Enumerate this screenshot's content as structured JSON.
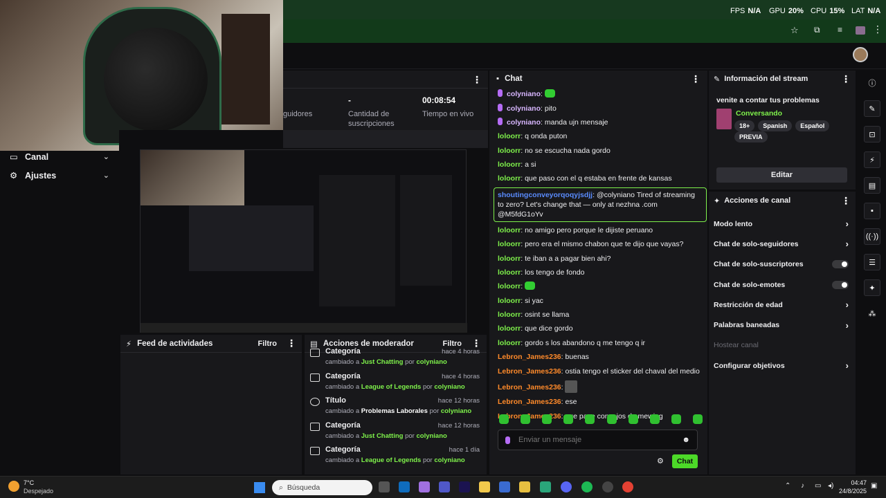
{
  "overlay": {
    "fps_label": "FPS",
    "fps_value": "N/A",
    "gpu_label": "GPU",
    "gpu_value": "20%",
    "cpu_label": "CPU",
    "cpu_value": "15%",
    "lat_label": "LAT",
    "lat_value": "N/A"
  },
  "stats": {
    "followers_label": "guidores",
    "subs_value": "-",
    "subs_label": "Cantidad de suscripciones",
    "live_value": "00:08:54",
    "live_label": "Tiempo en vivo"
  },
  "sidebar": {
    "items": [
      {
        "label": "Canal"
      },
      {
        "label": "Ajustes"
      }
    ]
  },
  "feed": {
    "title": "Feed de actividades",
    "filter": "Filtro"
  },
  "modactions": {
    "title": "Acciones de moderador",
    "filter": "Filtro",
    "items": [
      {
        "title": "Categoría",
        "time": "hace 4 horas",
        "prefix": "cambiado a",
        "value": "Just Chatting",
        "by": "por",
        "user": "colyniano"
      },
      {
        "title": "Categoría",
        "time": "hace 4 horas",
        "prefix": "cambiado a",
        "value": "League of Legends",
        "by": "por",
        "user": "colyniano"
      },
      {
        "title": "Título",
        "time": "hace 12 horas",
        "prefix": "cambiado a",
        "value": "Problemas Laborales",
        "by": "por",
        "user": "colyniano"
      },
      {
        "title": "Categoría",
        "time": "hace 12 horas",
        "prefix": "cambiado a",
        "value": "Just Chatting",
        "by": "por",
        "user": "colyniano"
      },
      {
        "title": "Categoría",
        "time": "hace 1 día",
        "prefix": "cambiado a",
        "value": "League of Legends",
        "by": "por",
        "user": "colyniano"
      }
    ]
  },
  "chat": {
    "title": "Chat",
    "messages": [
      {
        "user": "colyniano",
        "cls": "u-coly",
        "mic": true,
        "text": "",
        "emote": true
      },
      {
        "user": "colyniano",
        "cls": "u-coly",
        "mic": true,
        "text": "pito"
      },
      {
        "user": "colyniano",
        "cls": "u-coly",
        "mic": true,
        "text": "manda ujn mensaje"
      },
      {
        "user": "loloorr",
        "cls": "u-loo",
        "text": "q onda puton"
      },
      {
        "user": "loloorr",
        "cls": "u-loo",
        "text": "no se escucha nada gordo"
      },
      {
        "user": "loloorr",
        "cls": "u-loo",
        "text": "a si"
      },
      {
        "user": "loloorr",
        "cls": "u-loo",
        "text": "que paso con el q estaba en frente de kansas"
      },
      {
        "user": "shoutingconveyorqoqyjsdjj",
        "cls": "u-sh",
        "text": "@colyniano Tired of streaming to zero? Let's change that — only at nezhna .com @M5fdG1oYv",
        "highlight": true
      },
      {
        "user": "loloorr",
        "cls": "u-loo",
        "text": "no amigo pero porque le dijiste peruano"
      },
      {
        "user": "loloorr",
        "cls": "u-loo",
        "text": "pero era el mismo chabon que te dijo que vayas?"
      },
      {
        "user": "loloorr",
        "cls": "u-loo",
        "text": "te iban a a pagar bien ahi?"
      },
      {
        "user": "loloorr",
        "cls": "u-loo",
        "text": "los tengo de fondo"
      },
      {
        "user": "loloorr",
        "cls": "u-loo",
        "text": "",
        "emote": true
      },
      {
        "user": "loloorr",
        "cls": "u-loo",
        "text": "si yac"
      },
      {
        "user": "loloorr",
        "cls": "u-loo",
        "text": "osint se llama"
      },
      {
        "user": "loloorr",
        "cls": "u-loo",
        "text": "que dice gordo"
      },
      {
        "user": "loloorr",
        "cls": "u-loo",
        "text": "gordo s los abandono q me tengo q ir"
      },
      {
        "user": "Lebron_James236",
        "cls": "u-leb",
        "text": "buenas"
      },
      {
        "user": "Lebron_James236",
        "cls": "u-leb",
        "text": "ostia tengo el sticker del chaval del medio"
      },
      {
        "user": "Lebron_James236",
        "cls": "u-leb",
        "text": "",
        "image": true
      },
      {
        "user": "Lebron_James236",
        "cls": "u-leb",
        "text": "ese"
      },
      {
        "user": "Lebron_James236",
        "cls": "u-leb",
        "text": "que pase consejos de mewing"
      }
    ],
    "input_placeholder": "Enviar un mensaje",
    "send_label": "Chat"
  },
  "streaminfo": {
    "header": "Información del stream",
    "title": "venite a contar tus problemas",
    "category": "Conversando",
    "tags": [
      "18+",
      "Spanish",
      "Español",
      "PREVIA"
    ],
    "edit_label": "Editar"
  },
  "channelactions": {
    "header": "Acciones de canal",
    "items": [
      {
        "label": "Modo lento",
        "kind": "chev"
      },
      {
        "label": "Chat de solo-seguidores",
        "kind": "chev"
      },
      {
        "label": "Chat de solo-suscriptores",
        "kind": "toggle"
      },
      {
        "label": "Chat de solo-emotes",
        "kind": "toggle"
      },
      {
        "label": "Restricción de edad",
        "kind": "chev"
      },
      {
        "label": "Palabras baneadas",
        "kind": "chev"
      },
      {
        "label": "Hostear canal",
        "kind": "disabled"
      },
      {
        "label": "Configurar objetivos",
        "kind": "chev"
      }
    ]
  },
  "taskbar": {
    "weather_temp": "7°C",
    "weather_desc": "Despejado",
    "search_placeholder": "Búsqueda",
    "time": "04:47",
    "date": "24/8/2025"
  },
  "colors": {
    "accent": "#7ff24b",
    "bg": "#0e0e10",
    "panel": "#18181b"
  }
}
